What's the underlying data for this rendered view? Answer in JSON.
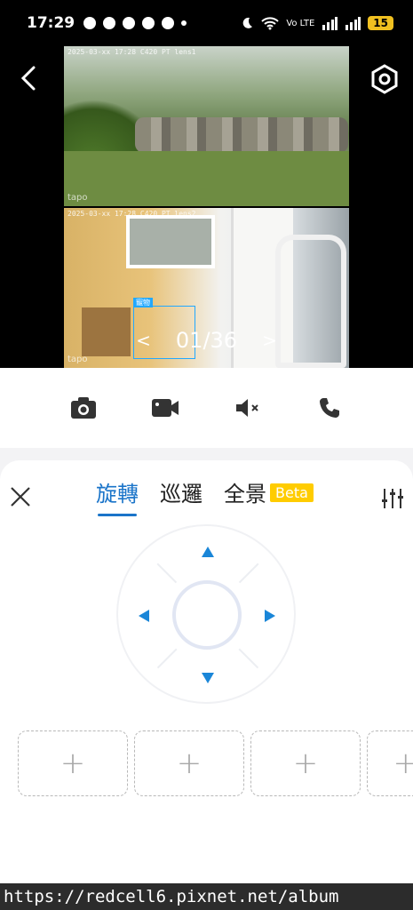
{
  "status_bar": {
    "time": "17:29",
    "network": "Vo LTE",
    "battery": "15"
  },
  "video": {
    "stamp_top": "2025-03-xx 17:28 C420 PT lens1",
    "stamp_bottom": "2025-03-xx 17:28 C420 PT lens2",
    "logo": "tapo",
    "detection_label": "寵物",
    "pager": {
      "prev": "<",
      "current": "01/36",
      "next": ">"
    }
  },
  "toolbar": {
    "items": [
      "camera-icon",
      "video-record-icon",
      "mute-icon",
      "phone-icon"
    ]
  },
  "panel": {
    "tabs": [
      {
        "label": "旋轉",
        "active": true
      },
      {
        "label": "巡邏",
        "active": false
      },
      {
        "label": "全景",
        "active": false
      }
    ],
    "beta_label": "Beta",
    "presets": [
      "+",
      "+",
      "+",
      "+"
    ]
  },
  "watermark": "https://redcell6.pixnet.net/album",
  "colors": {
    "accent": "#1a74c9",
    "arrow": "#1a86d8",
    "beta": "#ffcc00"
  }
}
